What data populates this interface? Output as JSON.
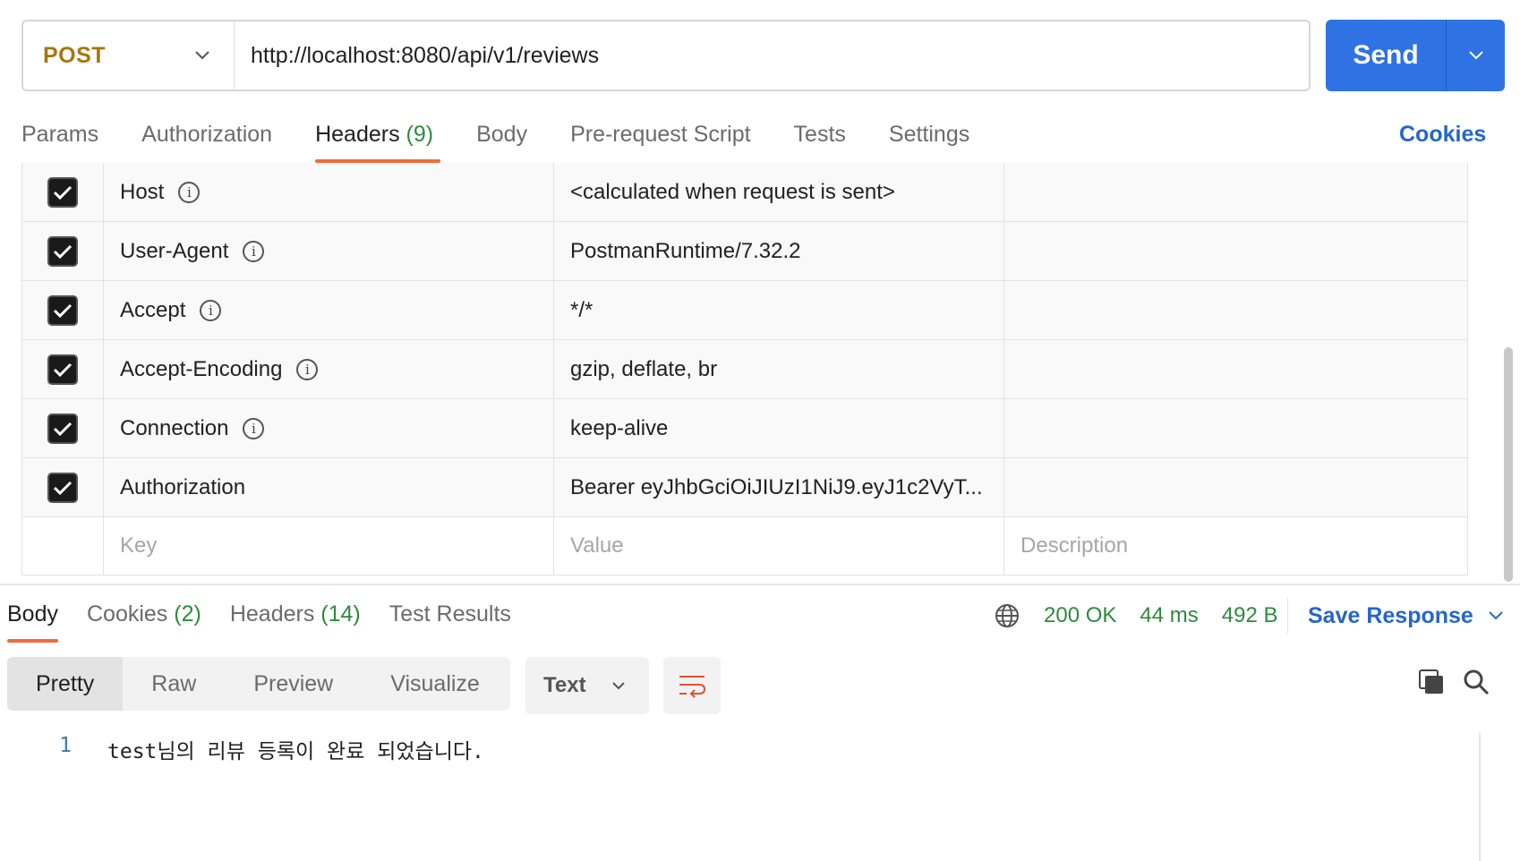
{
  "request": {
    "method": "POST",
    "url": "http://localhost:8080/api/v1/reviews",
    "send_label": "Send"
  },
  "request_tabs": [
    {
      "label": "Params",
      "count": ""
    },
    {
      "label": "Authorization",
      "count": ""
    },
    {
      "label": "Headers",
      "count": "(9)"
    },
    {
      "label": "Body",
      "count": ""
    },
    {
      "label": "Pre-request Script",
      "count": ""
    },
    {
      "label": "Tests",
      "count": ""
    },
    {
      "label": "Settings",
      "count": ""
    }
  ],
  "cookies_link": "Cookies",
  "headers": [
    {
      "key": "Host",
      "value": "<calculated when request is sent>",
      "checked": true
    },
    {
      "key": "User-Agent",
      "value": "PostmanRuntime/7.32.2",
      "checked": true
    },
    {
      "key": "Accept",
      "value": "*/*",
      "checked": true
    },
    {
      "key": "Accept-Encoding",
      "value": "gzip, deflate, br",
      "checked": true
    },
    {
      "key": "Connection",
      "value": "keep-alive",
      "checked": true
    },
    {
      "key": "Authorization",
      "value": "Bearer eyJhbGciOiJIUzI1NiJ9.eyJ1c2VyT...",
      "checked": true
    }
  ],
  "new_row": {
    "key_placeholder": "Key",
    "value_placeholder": "Value",
    "desc_placeholder": "Description"
  },
  "response_tabs": [
    {
      "label": "Body",
      "count": ""
    },
    {
      "label": "Cookies",
      "count": "(2)"
    },
    {
      "label": "Headers",
      "count": "(14)"
    },
    {
      "label": "Test Results",
      "count": ""
    }
  ],
  "status": {
    "code": "200 OK",
    "time": "44 ms",
    "size": "492 B"
  },
  "save_response": "Save Response",
  "view_modes": [
    "Pretty",
    "Raw",
    "Preview",
    "Visualize"
  ],
  "format": "Text",
  "body_lines": [
    {
      "n": "1",
      "text": "test님의 리뷰 등록이 완료 되었습니다."
    }
  ],
  "colors": {
    "accent": "#2f72e4",
    "tab_underline": "#f26b3a",
    "status_green": "#2e8b3d",
    "method_post": "#a8760f"
  }
}
